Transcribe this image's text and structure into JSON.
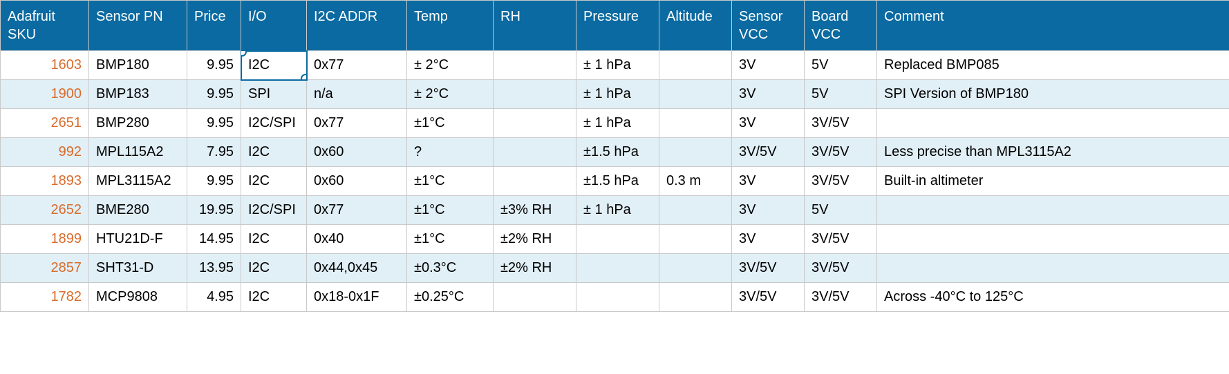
{
  "headers": {
    "sku": "Adafruit SKU",
    "pn": "Sensor PN",
    "price": "Price",
    "io": "I/O",
    "addr": "I2C ADDR",
    "temp": "Temp",
    "rh": "RH",
    "press": "Pressure",
    "alt": "Altitude",
    "svcc": "Sensor VCC",
    "bvcc": "Board VCC",
    "comment": "Comment"
  },
  "rows": [
    {
      "sku": "1603",
      "pn": "BMP180",
      "price": "9.95",
      "io": "I2C",
      "addr": "0x77",
      "temp": "± 2°C",
      "rh": "",
      "press": "± 1 hPa",
      "alt": "",
      "svcc": "3V",
      "bvcc": "5V",
      "comment": "Replaced BMP085"
    },
    {
      "sku": "1900",
      "pn": "BMP183",
      "price": "9.95",
      "io": "SPI",
      "addr": "n/a",
      "temp": "± 2°C",
      "rh": "",
      "press": "± 1 hPa",
      "alt": "",
      "svcc": "3V",
      "bvcc": "5V",
      "comment": "SPI Version of BMP180"
    },
    {
      "sku": "2651",
      "pn": "BMP280",
      "price": "9.95",
      "io": "I2C/SPI",
      "addr": "0x77",
      "temp": "±1°C",
      "rh": "",
      "press": "± 1 hPa",
      "alt": "",
      "svcc": "3V",
      "bvcc": "3V/5V",
      "comment": ""
    },
    {
      "sku": "992",
      "pn": "MPL115A2",
      "price": "7.95",
      "io": "I2C",
      "addr": "0x60",
      "temp": "?",
      "rh": "",
      "press": "±1.5 hPa",
      "alt": "",
      "svcc": "3V/5V",
      "bvcc": "3V/5V",
      "comment": "Less precise than MPL3115A2"
    },
    {
      "sku": "1893",
      "pn": "MPL3115A2",
      "price": "9.95",
      "io": "I2C",
      "addr": "0x60",
      "temp": "±1°C",
      "rh": "",
      "press": "±1.5 hPa",
      "alt": "0.3 m",
      "svcc": "3V",
      "bvcc": "3V/5V",
      "comment": "Built-in altimeter"
    },
    {
      "sku": "2652",
      "pn": "BME280",
      "price": "19.95",
      "io": "I2C/SPI",
      "addr": "0x77",
      "temp": "±1°C",
      "rh": "±3% RH",
      "press": "± 1 hPa",
      "alt": "",
      "svcc": "3V",
      "bvcc": "5V",
      "comment": ""
    },
    {
      "sku": "1899",
      "pn": "HTU21D-F",
      "price": "14.95",
      "io": "I2C",
      "addr": "0x40",
      "temp": "±1°C",
      "rh": "±2% RH",
      "press": "",
      "alt": "",
      "svcc": "3V",
      "bvcc": "3V/5V",
      "comment": ""
    },
    {
      "sku": "2857",
      "pn": "SHT31-D",
      "price": "13.95",
      "io": "I2C",
      "addr": "0x44,0x45",
      "temp": "±0.3°C",
      "rh": "±2% RH",
      "press": "",
      "alt": "",
      "svcc": "3V/5V",
      "bvcc": "3V/5V",
      "comment": ""
    },
    {
      "sku": "1782",
      "pn": "MCP9808",
      "price": "4.95",
      "io": "I2C",
      "addr": "0x18-0x1F",
      "temp": "±0.25°C",
      "rh": "",
      "press": "",
      "alt": "",
      "svcc": "3V/5V",
      "bvcc": "3V/5V",
      "comment": "Across -40°C to 125°C"
    }
  ],
  "selected": {
    "row": 0,
    "col": "io"
  }
}
